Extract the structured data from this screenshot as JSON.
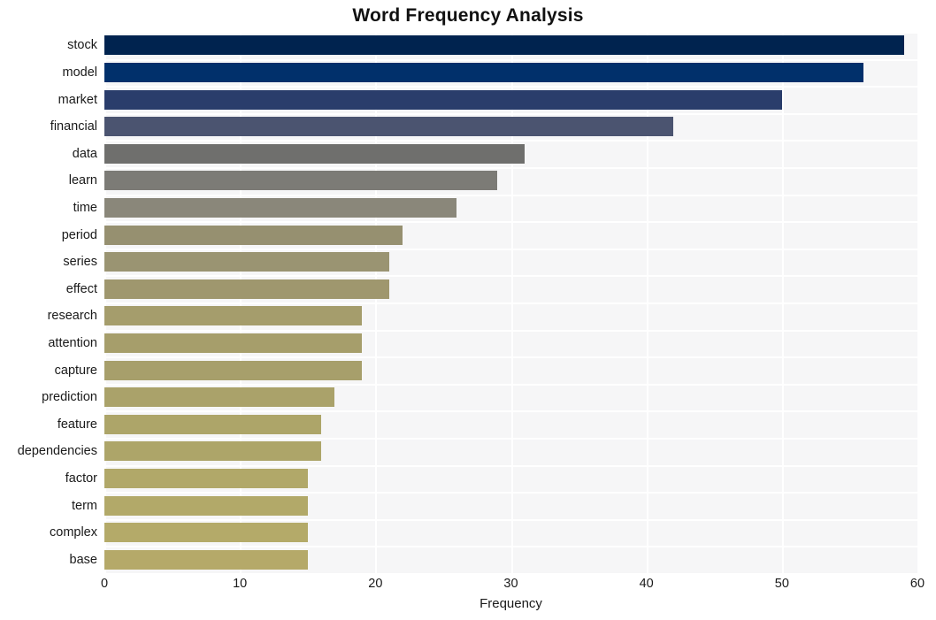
{
  "chart_data": {
    "type": "bar",
    "orientation": "horizontal",
    "title": "Word Frequency Analysis",
    "xlabel": "Frequency",
    "ylabel": "",
    "xlim": [
      0,
      60
    ],
    "xticks": [
      0,
      10,
      20,
      30,
      40,
      50,
      60
    ],
    "xtick_labels": [
      "0",
      "10",
      "20",
      "30",
      "40",
      "50",
      "60"
    ],
    "grid": true,
    "grid_color": "#ffffff",
    "plot_background": "#f6f6f7",
    "legend": null,
    "categories": [
      "stock",
      "model",
      "market",
      "financial",
      "data",
      "learn",
      "time",
      "period",
      "series",
      "effect",
      "research",
      "attention",
      "capture",
      "prediction",
      "feature",
      "dependencies",
      "factor",
      "term",
      "complex",
      "base"
    ],
    "values": [
      59,
      56,
      50,
      42,
      31,
      29,
      26,
      22,
      21,
      21,
      19,
      19,
      19,
      17,
      16,
      16,
      15,
      15,
      15,
      15
    ],
    "bar_colors": [
      "#00234f",
      "#01306b",
      "#2a3d6b",
      "#4b5470",
      "#6f6f6d",
      "#7c7b76",
      "#8a877a",
      "#969070",
      "#9a9472",
      "#9f976e",
      "#a59d6c",
      "#a69e6b",
      "#a79f6b",
      "#aaa26a",
      "#ada569",
      "#ada569",
      "#b1a869",
      "#b2a969",
      "#b4aa69",
      "#b5a969"
    ]
  }
}
